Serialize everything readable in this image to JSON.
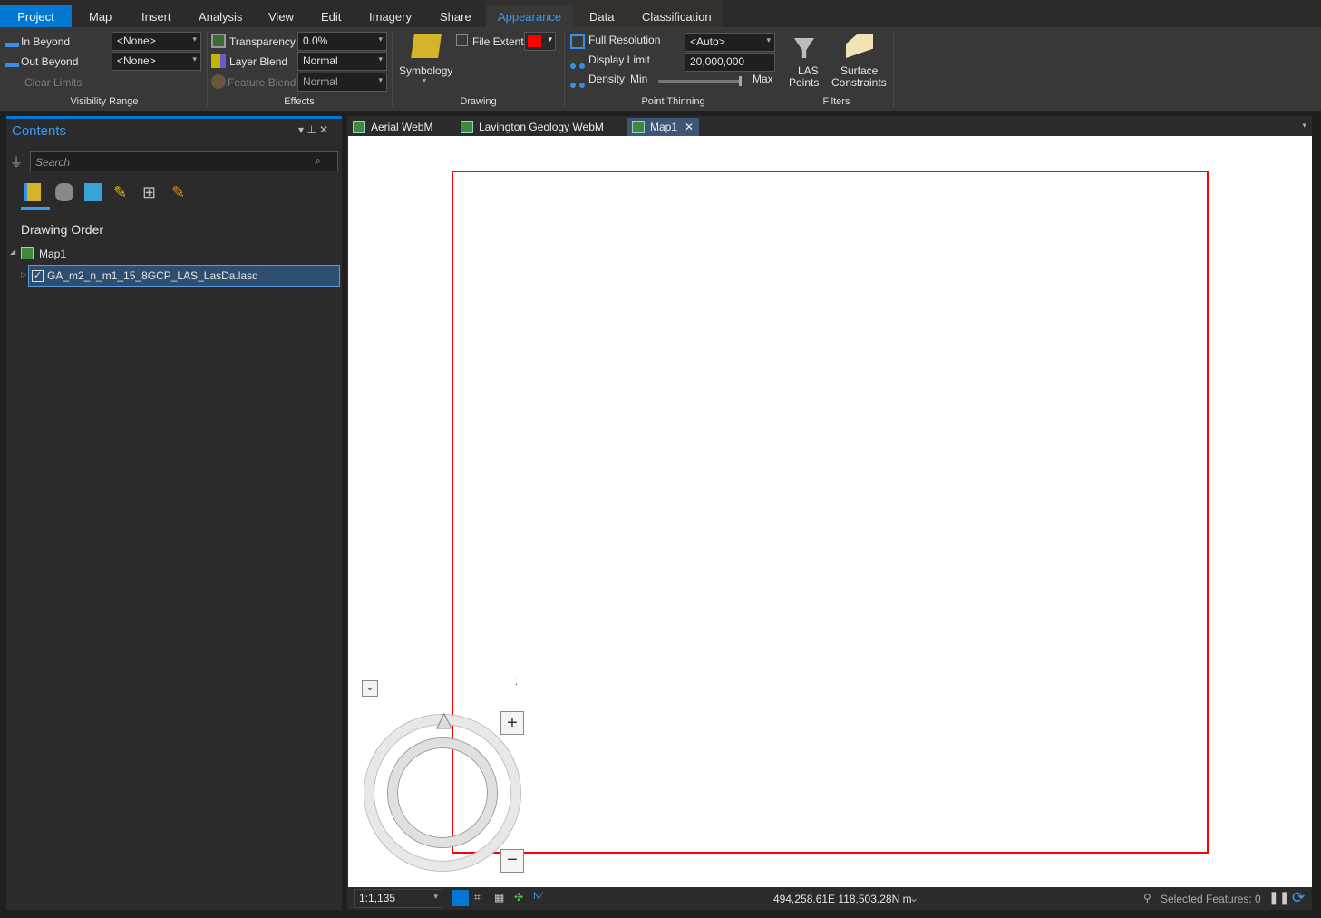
{
  "tabs": {
    "project": "Project",
    "items": [
      "Map",
      "Insert",
      "Analysis",
      "View",
      "Edit",
      "Imagery",
      "Share",
      "Appearance",
      "Data",
      "Classification"
    ]
  },
  "ribbon": {
    "visibility": {
      "in_beyond": "In Beyond",
      "out_beyond": "Out Beyond",
      "clear_limits": "Clear Limits",
      "in_value": "<None>",
      "out_value": "<None>",
      "group": "Visibility Range"
    },
    "effects": {
      "transparency": "Transparency",
      "transparency_value": "0.0%",
      "layer_blend": "Layer Blend",
      "layer_blend_value": "Normal",
      "feature_blend": "Feature Blend",
      "feature_blend_value": "Normal",
      "group": "Effects"
    },
    "drawing": {
      "symbology": "Symbology",
      "file_extent": "File Extent",
      "extent_color": "#ff0000",
      "group": "Drawing"
    },
    "thinning": {
      "full_resolution": "Full Resolution",
      "display_limit": "Display Limit",
      "density": "Density",
      "min": "Min",
      "max": "Max",
      "auto_value": "<Auto>",
      "limit_value": "20,000,000",
      "density_level": 1.0,
      "group": "Point Thinning"
    },
    "filters": {
      "las_line1": "LAS",
      "las_line2": "Points",
      "surface_line1": "Surface",
      "surface_line2": "Constraints",
      "group": "Filters"
    }
  },
  "contents": {
    "title": "Contents",
    "search_placeholder": "Search",
    "heading": "Drawing Order",
    "map": "Map1",
    "layer": "GA_m2_n_m1_15_8GCP_LAS_LasDa.lasd"
  },
  "views": [
    "Aerial WebM",
    "Lavington Geology WebM",
    "Map1"
  ],
  "status": {
    "scale": "1:1,135",
    "coords": "494,258.61E 118,503.28N m",
    "selected": "Selected Features: 0"
  }
}
